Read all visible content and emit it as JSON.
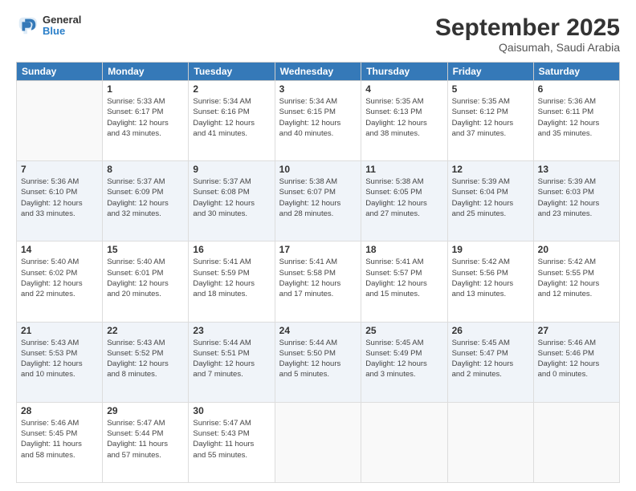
{
  "header": {
    "logo_general": "General",
    "logo_blue": "Blue",
    "month": "September 2025",
    "location": "Qaisumah, Saudi Arabia"
  },
  "days_of_week": [
    "Sunday",
    "Monday",
    "Tuesday",
    "Wednesday",
    "Thursday",
    "Friday",
    "Saturday"
  ],
  "weeks": [
    [
      {
        "day": "",
        "info": ""
      },
      {
        "day": "1",
        "info": "Sunrise: 5:33 AM\nSunset: 6:17 PM\nDaylight: 12 hours\nand 43 minutes."
      },
      {
        "day": "2",
        "info": "Sunrise: 5:34 AM\nSunset: 6:16 PM\nDaylight: 12 hours\nand 41 minutes."
      },
      {
        "day": "3",
        "info": "Sunrise: 5:34 AM\nSunset: 6:15 PM\nDaylight: 12 hours\nand 40 minutes."
      },
      {
        "day": "4",
        "info": "Sunrise: 5:35 AM\nSunset: 6:13 PM\nDaylight: 12 hours\nand 38 minutes."
      },
      {
        "day": "5",
        "info": "Sunrise: 5:35 AM\nSunset: 6:12 PM\nDaylight: 12 hours\nand 37 minutes."
      },
      {
        "day": "6",
        "info": "Sunrise: 5:36 AM\nSunset: 6:11 PM\nDaylight: 12 hours\nand 35 minutes."
      }
    ],
    [
      {
        "day": "7",
        "info": "Sunrise: 5:36 AM\nSunset: 6:10 PM\nDaylight: 12 hours\nand 33 minutes."
      },
      {
        "day": "8",
        "info": "Sunrise: 5:37 AM\nSunset: 6:09 PM\nDaylight: 12 hours\nand 32 minutes."
      },
      {
        "day": "9",
        "info": "Sunrise: 5:37 AM\nSunset: 6:08 PM\nDaylight: 12 hours\nand 30 minutes."
      },
      {
        "day": "10",
        "info": "Sunrise: 5:38 AM\nSunset: 6:07 PM\nDaylight: 12 hours\nand 28 minutes."
      },
      {
        "day": "11",
        "info": "Sunrise: 5:38 AM\nSunset: 6:05 PM\nDaylight: 12 hours\nand 27 minutes."
      },
      {
        "day": "12",
        "info": "Sunrise: 5:39 AM\nSunset: 6:04 PM\nDaylight: 12 hours\nand 25 minutes."
      },
      {
        "day": "13",
        "info": "Sunrise: 5:39 AM\nSunset: 6:03 PM\nDaylight: 12 hours\nand 23 minutes."
      }
    ],
    [
      {
        "day": "14",
        "info": "Sunrise: 5:40 AM\nSunset: 6:02 PM\nDaylight: 12 hours\nand 22 minutes."
      },
      {
        "day": "15",
        "info": "Sunrise: 5:40 AM\nSunset: 6:01 PM\nDaylight: 12 hours\nand 20 minutes."
      },
      {
        "day": "16",
        "info": "Sunrise: 5:41 AM\nSunset: 5:59 PM\nDaylight: 12 hours\nand 18 minutes."
      },
      {
        "day": "17",
        "info": "Sunrise: 5:41 AM\nSunset: 5:58 PM\nDaylight: 12 hours\nand 17 minutes."
      },
      {
        "day": "18",
        "info": "Sunrise: 5:41 AM\nSunset: 5:57 PM\nDaylight: 12 hours\nand 15 minutes."
      },
      {
        "day": "19",
        "info": "Sunrise: 5:42 AM\nSunset: 5:56 PM\nDaylight: 12 hours\nand 13 minutes."
      },
      {
        "day": "20",
        "info": "Sunrise: 5:42 AM\nSunset: 5:55 PM\nDaylight: 12 hours\nand 12 minutes."
      }
    ],
    [
      {
        "day": "21",
        "info": "Sunrise: 5:43 AM\nSunset: 5:53 PM\nDaylight: 12 hours\nand 10 minutes."
      },
      {
        "day": "22",
        "info": "Sunrise: 5:43 AM\nSunset: 5:52 PM\nDaylight: 12 hours\nand 8 minutes."
      },
      {
        "day": "23",
        "info": "Sunrise: 5:44 AM\nSunset: 5:51 PM\nDaylight: 12 hours\nand 7 minutes."
      },
      {
        "day": "24",
        "info": "Sunrise: 5:44 AM\nSunset: 5:50 PM\nDaylight: 12 hours\nand 5 minutes."
      },
      {
        "day": "25",
        "info": "Sunrise: 5:45 AM\nSunset: 5:49 PM\nDaylight: 12 hours\nand 3 minutes."
      },
      {
        "day": "26",
        "info": "Sunrise: 5:45 AM\nSunset: 5:47 PM\nDaylight: 12 hours\nand 2 minutes."
      },
      {
        "day": "27",
        "info": "Sunrise: 5:46 AM\nSunset: 5:46 PM\nDaylight: 12 hours\nand 0 minutes."
      }
    ],
    [
      {
        "day": "28",
        "info": "Sunrise: 5:46 AM\nSunset: 5:45 PM\nDaylight: 11 hours\nand 58 minutes."
      },
      {
        "day": "29",
        "info": "Sunrise: 5:47 AM\nSunset: 5:44 PM\nDaylight: 11 hours\nand 57 minutes."
      },
      {
        "day": "30",
        "info": "Sunrise: 5:47 AM\nSunset: 5:43 PM\nDaylight: 11 hours\nand 55 minutes."
      },
      {
        "day": "",
        "info": ""
      },
      {
        "day": "",
        "info": ""
      },
      {
        "day": "",
        "info": ""
      },
      {
        "day": "",
        "info": ""
      }
    ]
  ]
}
